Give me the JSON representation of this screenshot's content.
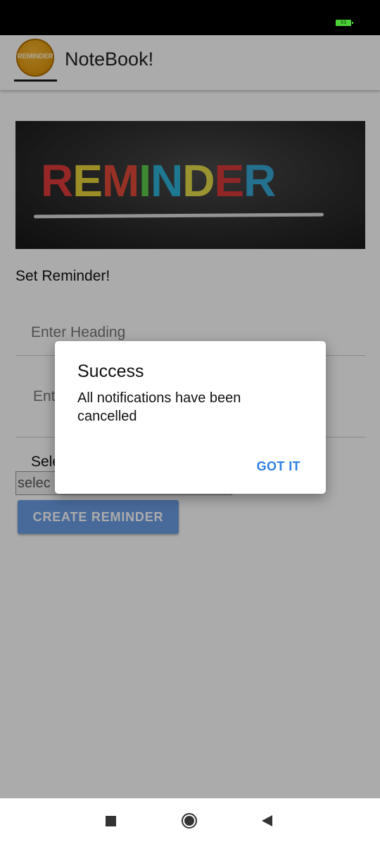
{
  "status_bar": {
    "battery": "93"
  },
  "app": {
    "title": "NoteBook!",
    "logo_text": "REMINDER"
  },
  "banner": {
    "letters": [
      {
        "ch": "R",
        "color": "#e03b3b"
      },
      {
        "ch": "E",
        "color": "#e8d43a"
      },
      {
        "ch": "M",
        "color": "#e24a3a"
      },
      {
        "ch": "I",
        "color": "#5dcb4b"
      },
      {
        "ch": "N",
        "color": "#2fb4d8"
      },
      {
        "ch": "D",
        "color": "#e6dc4a"
      },
      {
        "ch": "E",
        "color": "#d93a3a"
      },
      {
        "ch": "R",
        "color": "#37a8d6"
      }
    ]
  },
  "form": {
    "section_label": "Set Reminder!",
    "heading_placeholder": "Enter Heading",
    "description_placeholder": "Ent",
    "select_label": "Sele",
    "select_value": "selec",
    "create_button": "CREATE REMINDER"
  },
  "dialog": {
    "title": "Success",
    "message": "All notifications have been cancelled",
    "button": "GOT IT"
  },
  "colors": {
    "accent": "#2f80e0",
    "button_fill": "#6b9fe8",
    "status_bar": "#000000"
  },
  "nav": {
    "recents_icon": "square-icon",
    "home_icon": "circle-icon",
    "back_icon": "triangle-back-icon"
  }
}
